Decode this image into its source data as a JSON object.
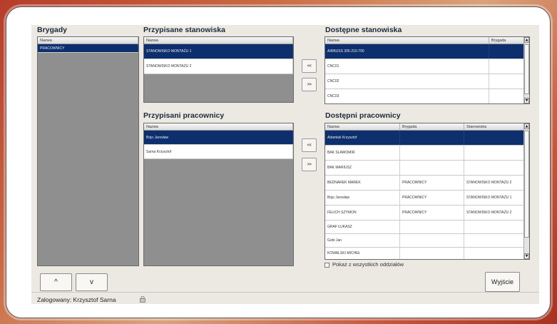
{
  "brigades": {
    "title": "Brygady",
    "column": "Nazwa",
    "rows": [
      "PRACOWNICY"
    ]
  },
  "assigned_positions": {
    "title": "Przypisane stanowiska",
    "column": "Nazwa",
    "rows": [
      "STANOWISKO MONTAŻU 1",
      "STANOWISKO MONTAŻU 2"
    ]
  },
  "available_positions": {
    "title": "Dostępne stanowiska",
    "columns": [
      "Nazwa",
      "Brygada"
    ],
    "rows": [
      [
        "AIRBUSS 305-210-700",
        ""
      ],
      [
        "CNC01",
        ""
      ],
      [
        "CNC02",
        ""
      ],
      [
        "CNC03",
        ""
      ]
    ]
  },
  "assigned_workers": {
    "title": "Przypisani pracownicy",
    "column": "Nazwa",
    "rows": [
      "Bojo Jarosław",
      "Sarna Krzysztof"
    ]
  },
  "available_workers": {
    "title": "Dostępni pracownicy",
    "columns": [
      "Nazwa",
      "Brygada",
      "Stanowiska"
    ],
    "rows": [
      [
        "Adamiak Krzysztof",
        "",
        ""
      ],
      [
        "BAK SLAWOMIR",
        "",
        ""
      ],
      [
        "BAK MARIUSZ",
        "",
        ""
      ],
      [
        "BEDNAREK MAREK",
        "PRACOWNICY",
        "STANOWISKO MONTAŻU 2"
      ],
      [
        "Bojo Jarosław",
        "PRACOWNICY",
        "STANOWISKO MONTAŻU 1"
      ],
      [
        "FELICH SZYMON",
        "PRACOWNICY",
        "STANOWISKO MONTAŻU 2"
      ],
      [
        "GRAF ŁUKASZ",
        "",
        ""
      ],
      [
        "Gobi Jan",
        "",
        ""
      ],
      [
        "KOWALSKI MICHEŁ",
        "",
        ""
      ]
    ]
  },
  "transfer": {
    "add_label": "<<",
    "remove_label": ">>"
  },
  "show_all_label": "Pokaż z wszystkich oddziałów",
  "buttons": {
    "up": "^",
    "down": "v",
    "exit": "Wyjście"
  },
  "status": {
    "logged_in": "Zalogowany: Krzysztof Sarna"
  },
  "colors": {
    "selection": "#0d2f6d",
    "grid_background": "#8f8f8f",
    "window": "#ece9e2"
  }
}
